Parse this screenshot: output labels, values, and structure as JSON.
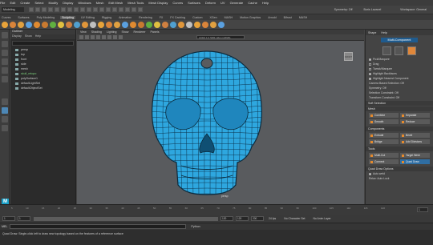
{
  "menubar": [
    "File",
    "Edit",
    "Create",
    "Select",
    "Modify",
    "Display",
    "Windows",
    "Mesh",
    "Edit Mesh",
    "Mesh Tools",
    "Mesh Display",
    "Curves",
    "Surfaces",
    "Deform",
    "UV",
    "Generate",
    "Cache",
    "Help"
  ],
  "status": {
    "mode": "Modeling",
    "symmetry": "Symmetry: Off",
    "user": "Boris Lavanel",
    "workspace": "Workspace: General"
  },
  "shelf_tabs": {
    "items": [
      "Curves",
      "Surfaces",
      "Poly Modeling",
      "Sculpting",
      "UV Editing",
      "Rigging",
      "Animation",
      "Rendering",
      "FX",
      "FX Caching",
      "Custom",
      "XGen",
      "MASH",
      "Motion Graphics",
      "Arnold",
      "Bifrost",
      "MASH"
    ],
    "active": 3
  },
  "outliner": {
    "title": "Outliner",
    "menus": [
      "Display",
      "Show",
      "Help"
    ],
    "items": [
      {
        "label": "persp",
        "green": false
      },
      {
        "label": "top",
        "green": false
      },
      {
        "label": "front",
        "green": false
      },
      {
        "label": "side",
        "green": false
      },
      {
        "label": "mesh",
        "green": false
      },
      {
        "label": "skull_retopo",
        "green": true
      },
      {
        "label": "polySurface1",
        "green": false
      },
      {
        "label": "defaultLightSet",
        "green": false
      },
      {
        "label": "defaultObjectSet",
        "green": false
      }
    ]
  },
  "viewport": {
    "menus": [
      "View",
      "Shading",
      "Lighting",
      "Show",
      "Renderer",
      "Panels"
    ],
    "input": "ACES 1.0 SDR-video (sRGB)",
    "camera": "persp",
    "cube_label": "FRONT"
  },
  "panel": {
    "tabs": [
      "Shape",
      "Help"
    ],
    "title": "Multi-Component",
    "options": [
      {
        "label": "Pick/Marquee",
        "on": true
      },
      {
        "label": "Drag",
        "on": false
      },
      {
        "label": "Tweak/Marquee",
        "on": false
      },
      {
        "label": "Highlight Backfaces",
        "on": true
      },
      {
        "label": "Highlight Nearest Component",
        "on": true
      }
    ],
    "lines": [
      "Camera Based Selection: Off",
      "Symmetry: Off",
      "Selection Constraint: Off",
      "Transform Constraint: Off"
    ],
    "sections": [
      {
        "title": "Soft Selection",
        "buttons": []
      },
      {
        "title": "Mesh",
        "buttons": [
          {
            "label": "Combine",
            "blue": false
          },
          {
            "label": "Separate",
            "blue": false
          },
          {
            "label": "Smooth",
            "blue": false
          },
          {
            "label": "Reduce",
            "blue": false
          }
        ]
      },
      {
        "title": "Components",
        "buttons": [
          {
            "label": "Extrude",
            "blue": false
          },
          {
            "label": "Bevel",
            "blue": false
          },
          {
            "label": "Bridge",
            "blue": false
          },
          {
            "label": "Add Divisions",
            "blue": false
          }
        ]
      },
      {
        "title": "Tools",
        "buttons": [
          {
            "label": "Multi-Cut",
            "blue": false
          },
          {
            "label": "Target Weld",
            "blue": false
          },
          {
            "label": "Connect",
            "blue": false
          },
          {
            "label": "Quad Draw",
            "blue": true
          }
        ]
      }
    ],
    "quad_title": "Quad Draw Options",
    "quad_line1": "Auto weld",
    "quad_line2": "Relax: Auto Lock"
  },
  "timeslider": {
    "ticks": [
      "5",
      "10",
      "15",
      "20",
      "25",
      "30",
      "35",
      "40",
      "45",
      "50",
      "55",
      "60",
      "65",
      "70",
      "75",
      "80",
      "85",
      "90",
      "95",
      "100",
      "105",
      "110",
      "115",
      "120"
    ],
    "current": "1"
  },
  "range": {
    "start": "1",
    "start2": "1",
    "end": "120",
    "end2": "120",
    "end3": "200",
    "fps": "24 fps",
    "char": "No Character Set",
    "anim": "No Anim Layer"
  },
  "cmd": {
    "mel": "MEL",
    "script": "Python"
  },
  "help": "Quad Draw: Single-click left to draw new topology based on the features of a reference surface",
  "colors": {
    "accent": "#2f6ea3",
    "mesh": "#2fa8e0",
    "shelf": [
      "#e8a33a",
      "#d9843a",
      "#e0a040",
      "#5aa0e0",
      "#e08a30",
      "#c97a30",
      "#60b040",
      "#e0c040",
      "#d08040",
      "#50a0d0",
      "#e0963a",
      "#c0c0c0"
    ]
  }
}
